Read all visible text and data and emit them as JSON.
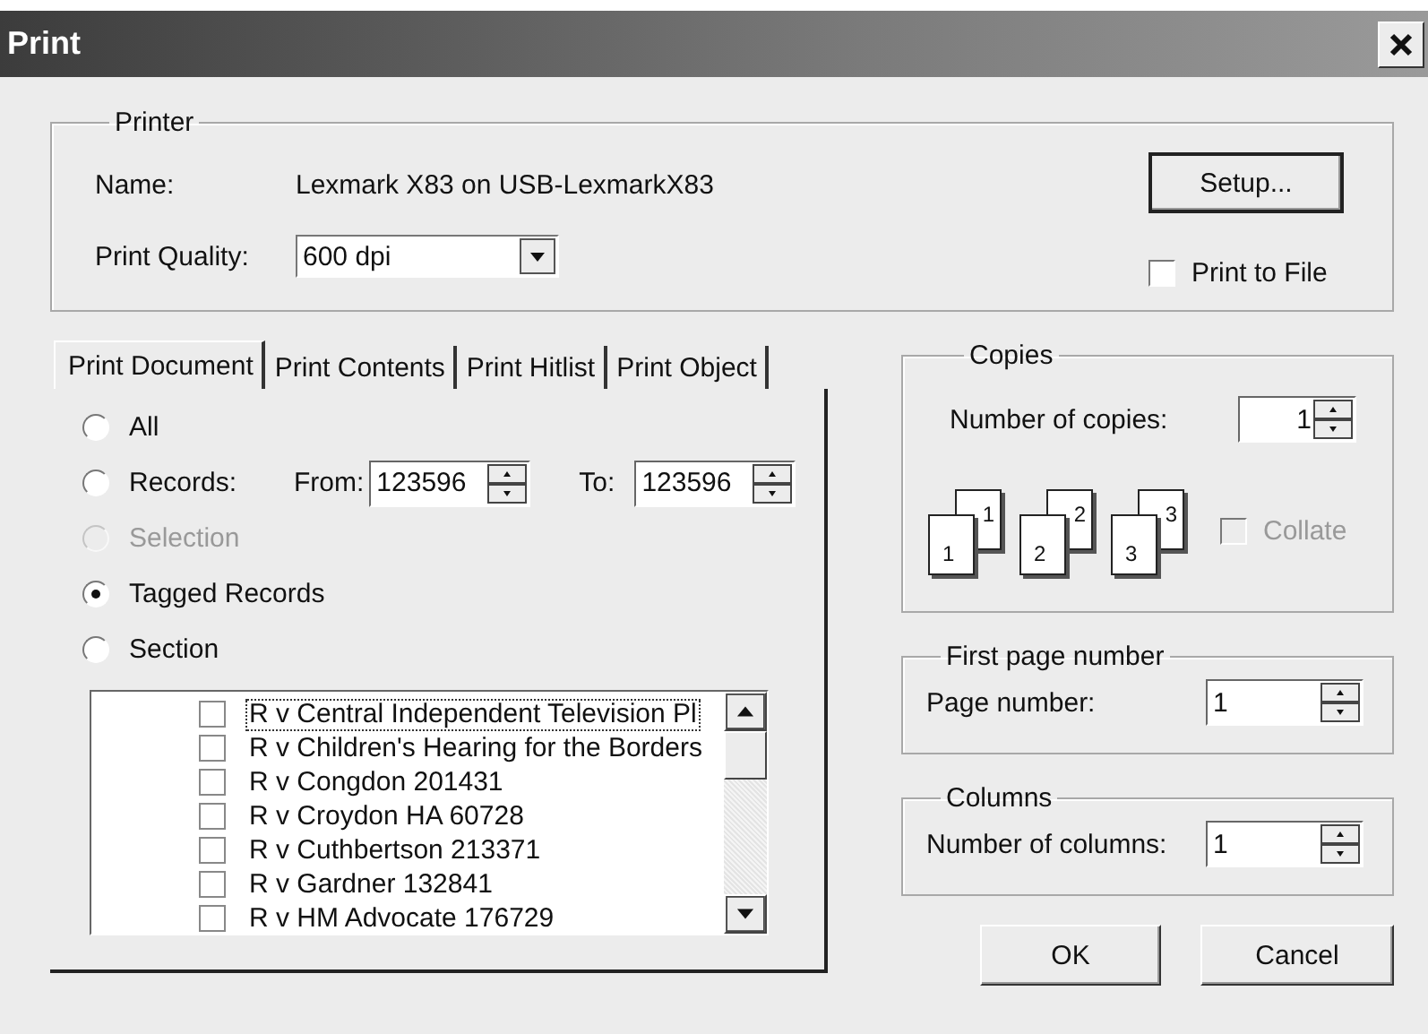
{
  "window": {
    "title": "Print"
  },
  "printer": {
    "legend": "Printer",
    "name_label": "Name:",
    "name_value": "Lexmark X83 on USB-LexmarkX83",
    "quality_label": "Print Quality:",
    "quality_value": "600 dpi",
    "setup_button": "Setup...",
    "print_to_file": {
      "label": "Print to File",
      "checked": false
    }
  },
  "tabs": [
    {
      "label": "Print Document",
      "selected": true
    },
    {
      "label": "Print Contents",
      "selected": false
    },
    {
      "label": "Print Hitlist",
      "selected": false
    },
    {
      "label": "Print Object",
      "selected": false
    }
  ],
  "range_options": [
    {
      "kind": "plain",
      "label": "All",
      "selected": false,
      "disabled": false
    },
    {
      "kind": "range",
      "label": "Records:",
      "selected": false,
      "disabled": false,
      "from_label": "From:",
      "from_value": "123596",
      "to_label": "To:",
      "to_value": "123596"
    },
    {
      "kind": "plain",
      "label": "Selection",
      "selected": false,
      "disabled": true
    },
    {
      "kind": "plain",
      "label": "Tagged Records",
      "selected": true,
      "disabled": false
    },
    {
      "kind": "plain",
      "label": "Section",
      "selected": false,
      "disabled": false
    }
  ],
  "records_list": [
    {
      "label": "R v Central Independent Television Pl",
      "checked": false,
      "focused": true
    },
    {
      "label": "R v Children's Hearing for the Borders",
      "checked": false,
      "focused": false
    },
    {
      "label": "R v Congdon 201431",
      "checked": false,
      "focused": false
    },
    {
      "label": "R v Croydon HA 60728",
      "checked": false,
      "focused": false
    },
    {
      "label": "R v Cuthbertson 213371",
      "checked": false,
      "focused": false
    },
    {
      "label": "R v Gardner 132841",
      "checked": false,
      "focused": false
    },
    {
      "label": "R v HM Advocate 176729",
      "checked": false,
      "focused": false
    }
  ],
  "copies": {
    "legend": "Copies",
    "label": "Number of copies:",
    "value": "1",
    "collate_pages": [
      {
        "front": "1",
        "back": "1"
      },
      {
        "front": "2",
        "back": "2"
      },
      {
        "front": "3",
        "back": "3"
      }
    ],
    "collate": {
      "label": "Collate",
      "checked": false,
      "disabled": true
    }
  },
  "first_page": {
    "legend": "First page number",
    "label": "Page number:",
    "value": "1"
  },
  "columns": {
    "legend": "Columns",
    "label": "Number of columns:",
    "value": "1"
  },
  "buttons": [
    {
      "label": "OK"
    },
    {
      "label": "Cancel"
    }
  ]
}
